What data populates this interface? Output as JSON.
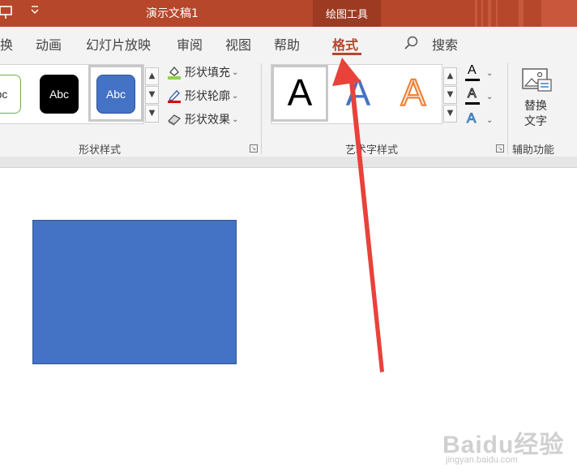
{
  "window": {
    "title": "演示文稿1",
    "contextual_tab_group": "绘图工具",
    "accent_color": "#b7472a"
  },
  "tabs": [
    {
      "label": "换",
      "active": false
    },
    {
      "label": "动画",
      "active": false
    },
    {
      "label": "幻灯片放映",
      "active": false
    },
    {
      "label": "审阅",
      "active": false
    },
    {
      "label": "视图",
      "active": false
    },
    {
      "label": "帮助",
      "active": false
    },
    {
      "label": "格式",
      "active": true
    }
  ],
  "search": {
    "label": "搜索",
    "icon": "search-icon"
  },
  "ribbon": {
    "shape_styles": {
      "group_label": "形状样式",
      "swatches": [
        {
          "text": "bc",
          "fill": "#ffffff",
          "border": "#70ad47",
          "text_color": "#333333"
        },
        {
          "text": "Abc",
          "fill": "#000000",
          "border": "#000000",
          "text_color": "#ffffff"
        },
        {
          "text": "Abc",
          "fill": "#4472c4",
          "border": "#2f5597",
          "text_color": "#ffffff",
          "selected": true
        }
      ],
      "fill_label": "形状填充",
      "outline_label": "形状轮廓",
      "effects_label": "形状效果"
    },
    "wordart_styles": {
      "group_label": "艺术字样式",
      "samples": [
        {
          "glyph": "A",
          "style": "black",
          "selected": true
        },
        {
          "glyph": "A",
          "style": "blue-gradient"
        },
        {
          "glyph": "A",
          "style": "orange-outline"
        }
      ],
      "text_fill_glyph": "A",
      "text_outline_glyph": "A",
      "text_effects_glyph": "A"
    },
    "accessibility": {
      "group_label": "辅助功能",
      "alt_text_line1": "替换",
      "alt_text_line2": "文字"
    }
  },
  "canvas": {
    "shape_fill": "#4472c4",
    "shape_border": "#2f5597",
    "annotation_arrow_color": "#e8423b"
  },
  "watermark": {
    "brand": "Baidu经验",
    "url": "jingyan.baidu.com"
  }
}
